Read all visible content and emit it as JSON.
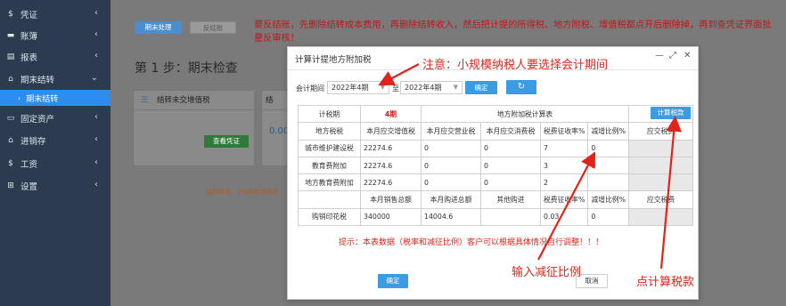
{
  "sidebar": {
    "items": [
      {
        "label": "凭证",
        "icon": "dollar-icon",
        "glyph": "$"
      },
      {
        "label": "账簿",
        "icon": "book-icon",
        "glyph": "▬"
      },
      {
        "label": "报表",
        "icon": "report-icon",
        "glyph": "▤"
      },
      {
        "label": "期末结转",
        "icon": "home-icon",
        "glyph": "⌂"
      },
      {
        "label": "固定资产",
        "icon": "monitor-icon",
        "glyph": "▭"
      },
      {
        "label": "进销存",
        "icon": "home-icon",
        "glyph": "⌂"
      },
      {
        "label": "工资",
        "icon": "dollar-icon",
        "glyph": "$"
      },
      {
        "label": "设置",
        "icon": "grid-icon",
        "glyph": "⊞"
      }
    ],
    "active_sub": "期末结转"
  },
  "main": {
    "btn_period_process": "期末处理",
    "btn_reverse": "反结账",
    "step_title": "第 1 步：期末检查",
    "card1_title": "结转未交增值税",
    "card1_button": "查看凭证",
    "card2_title": "结",
    "card2_value": "0.00",
    "footer_note": "结转步骤：1先结转增值税",
    "banner": "要反结账，先删除结转成本费用，再删除结转收入，然后把计提的所得税、地方附税、增值税都点开后删除掉，再到查凭证界面批量反审核！"
  },
  "modal": {
    "title": "计算计提地方附加税",
    "period_label": "会计期间",
    "period_from": "2022年4期",
    "to_label": "至",
    "period_to": "2022年4期",
    "confirm_small": "确定",
    "refresh_glyph": "↻",
    "calc_button": "计算税款",
    "ok_button": "确定",
    "cancel_button": "取消",
    "table": {
      "row1": [
        "计税期",
        "4期",
        "地方附加税计算表"
      ],
      "row2": [
        "地方税税",
        "本月应交增值税",
        "本月应交营业税",
        "本月应交消费税",
        "税费征收率%",
        "减增比例%",
        "应交税费"
      ],
      "rows": [
        [
          "城市维护建设税",
          "22274.6",
          "0",
          "0",
          "7",
          "0",
          ""
        ],
        [
          "教育费附加",
          "22274.6",
          "0",
          "0",
          "3",
          "0",
          ""
        ],
        [
          "地方教育费附加",
          "22274.6",
          "0",
          "0",
          "2",
          "",
          ""
        ]
      ],
      "row6": [
        "",
        "本月销售总额",
        "本月购进总额",
        "其他购进",
        "税费征收率%",
        "减增比例%",
        "应交税费"
      ],
      "row7": [
        "购销印花税",
        "340000",
        "14004.6",
        "",
        "0.03",
        "0",
        ""
      ]
    }
  },
  "annotations": {
    "top": "注意：小规模纳税人要选择会计期间",
    "tip": "提示：本表数据（税率和减征比例）客户可以根据具体情况自行调整！！！",
    "rate": "输入减征比例",
    "calc": "点计算税款"
  },
  "colors": {
    "sidebar_bg": "#2c3b4f",
    "active_blue": "#2d8cf0",
    "button_blue": "#3b9be3",
    "annotation_red": "#e2231a"
  }
}
